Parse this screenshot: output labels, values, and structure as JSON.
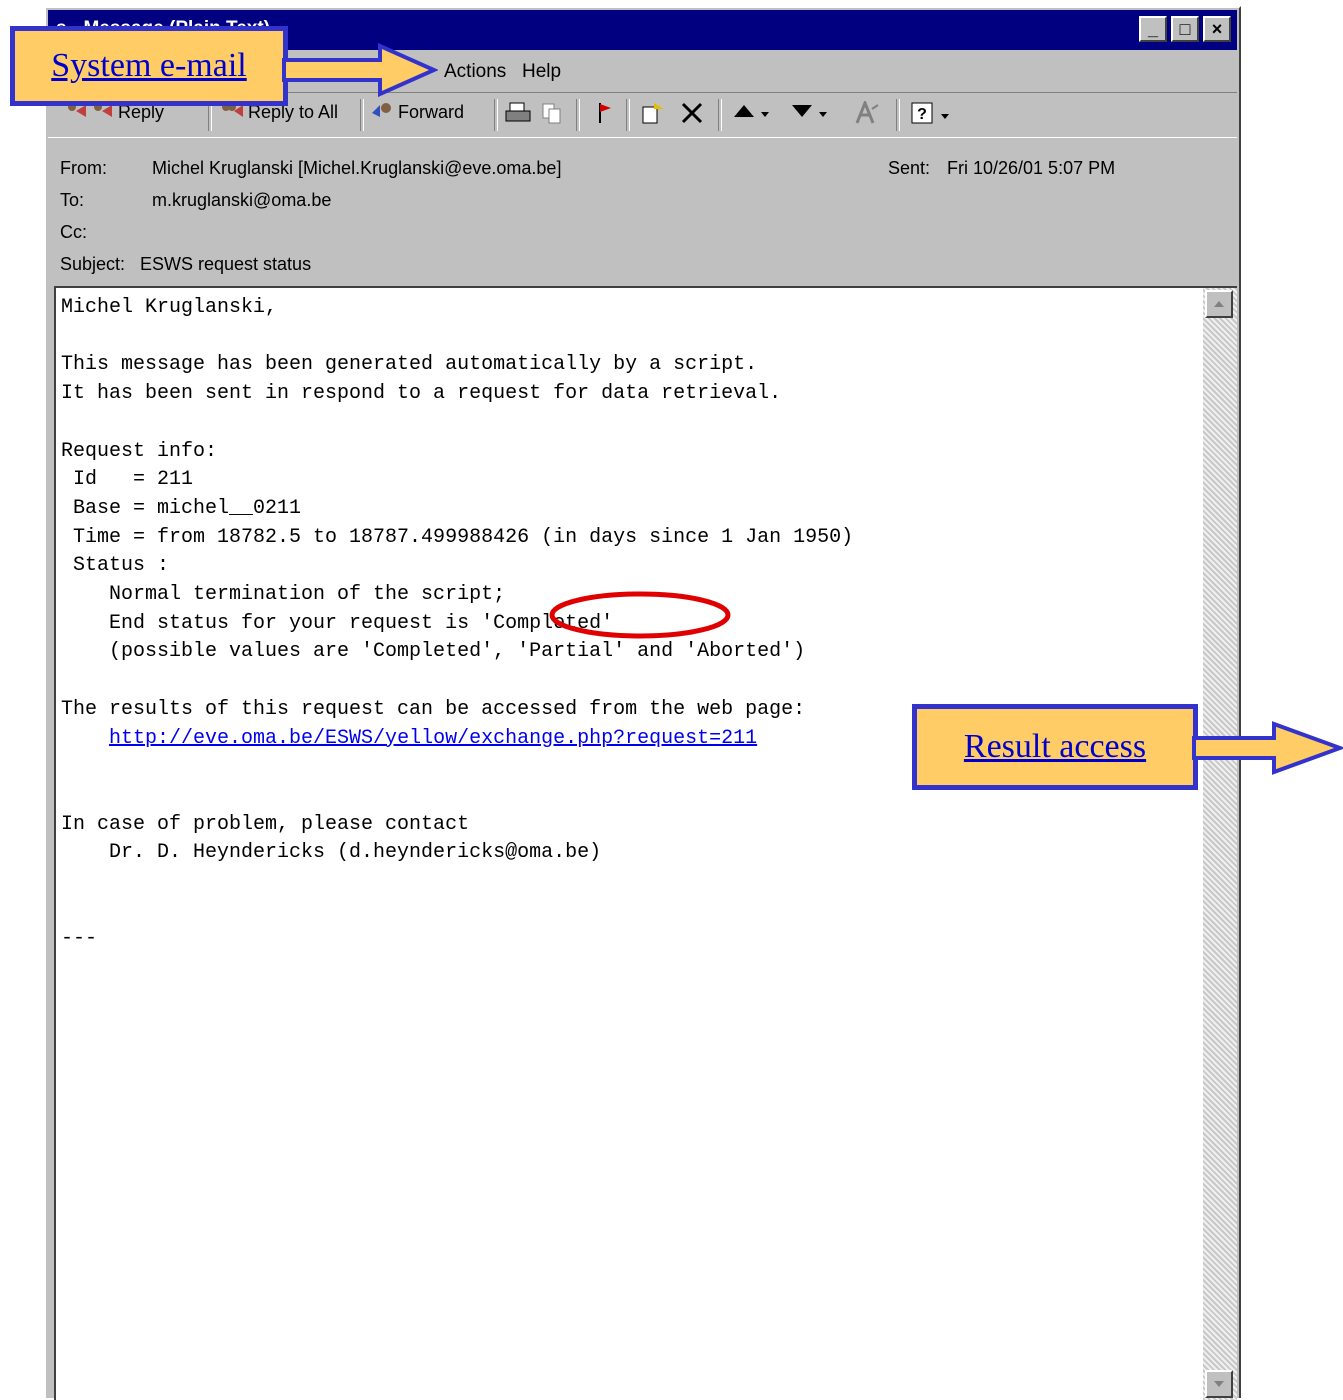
{
  "window": {
    "title": "s - Message (Plain Text)",
    "minimize": "_",
    "maximize": "□",
    "close": "×"
  },
  "menu": {
    "actions": "Actions",
    "help": "Help"
  },
  "toolbar": {
    "reply": "Reply",
    "reply_all": "Reply to All",
    "forward": "Forward"
  },
  "header": {
    "from_label": "From:",
    "from_value": "Michel Kruglanski [Michel.Kruglanski@eve.oma.be]",
    "sent_label": "Sent:",
    "sent_value": "Fri 10/26/01 5:07 PM",
    "to_label": "To:",
    "to_value": "m.kruglanski@oma.be",
    "cc_label": "Cc:",
    "cc_value": "",
    "subject_label": "Subject:",
    "subject_value": "ESWS request status"
  },
  "message": {
    "greeting": "Michel Kruglanski,",
    "intro1": "This message has been generated automatically by a script.",
    "intro2": "It has been sent in respond to a request for data retrieval.",
    "req_info": "Request info:",
    "id_line": " Id   = 211",
    "base_line": " Base = michel__0211",
    "time_line": " Time = from 18782.5 to 18787.499988426 (in days since 1 Jan 1950)",
    "status_line": " Status :",
    "term_line": "    Normal termination of the script;",
    "end_line": "    End status for your request is 'Completed'",
    "possible_line": "    (possible values are 'Completed', 'Partial' and 'Aborted')",
    "results_line": "The results of this request can be accessed from the web page:",
    "link_indent": "    ",
    "link": "http://eve.oma.be/ESWS/yellow/exchange.php?request=211",
    "problem_line": "In case of problem, please contact",
    "contact_line": "    Dr. D. Heyndericks (d.heyndericks@oma.be)",
    "sig": "---"
  },
  "callouts": {
    "system_email": "System e-mail",
    "result_access": "Result access"
  },
  "colors": {
    "callout_fill": "#ffcc66",
    "callout_border": "#3333cc",
    "highlight_ring": "#e00000",
    "titlebar": "#000080"
  }
}
